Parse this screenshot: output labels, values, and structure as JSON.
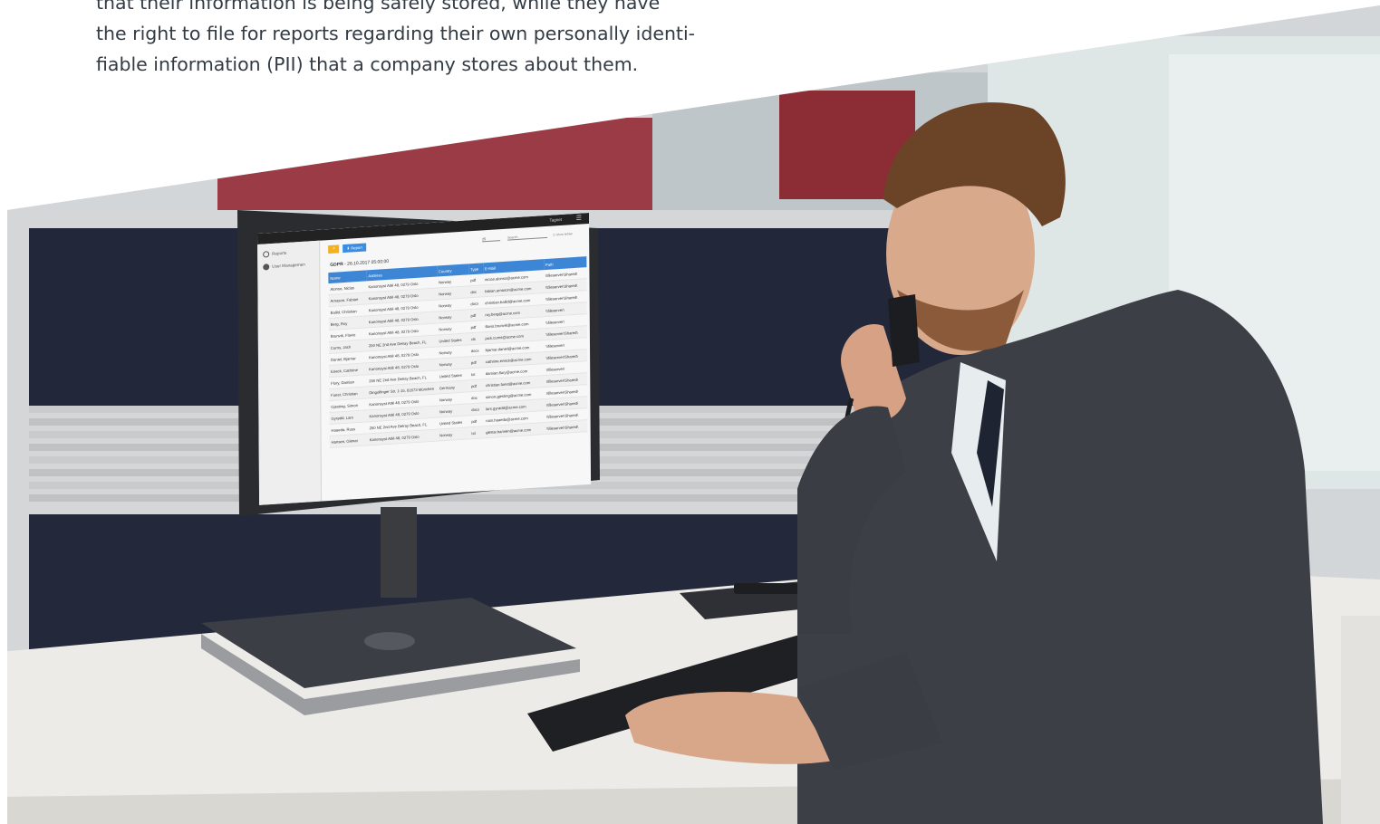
{
  "intro": {
    "lines": [
      "that their information is being safely stored, while they have",
      "the right to file for reports regarding their own personally identi-",
      "fiable information (PII) that a company stores about them."
    ]
  },
  "screen": {
    "brand": "Tagnet",
    "sidebar": [
      {
        "label": "Reports",
        "icon": "clock-icon"
      },
      {
        "label": "User Managemen",
        "icon": "user-icon"
      }
    ],
    "toolbar": {
      "yellow_label": "+",
      "blue_label": "⬇ Report",
      "select_value": "25",
      "search_placeholder": "Search",
      "checkbox_label": "☐ Show hidden"
    },
    "report_title_bold": "GDPR",
    "report_title_rest": " - 26.10.2017 05:00:00",
    "table": {
      "headers": [
        "Name",
        "Address",
        "Country",
        "Type",
        "E-Mail",
        "Path"
      ],
      "rows": [
        [
          "Alonso, Niclas",
          "Kanonsyst Atlé 48, 0279 Oslo",
          "Norway",
          "pdf",
          "nicias.alonso@acme.com",
          "\\\\fileserver\\Shared\\"
        ],
        [
          "Arnason, Fabian",
          "Kanonsyst Atlé 48, 0279 Oslo",
          "Norway",
          "doc",
          "fabian.arnason@acme.com",
          "\\\\fileserver\\Shared\\"
        ],
        [
          "Balild, Christian",
          "Kanonsyst Atlé 48, 0279 Oslo",
          "Norway",
          "docx",
          "christian.balild@acme.com",
          "\\\\fileserver\\Shared\\"
        ],
        [
          "Berg, Roy",
          "Kanonsyst Atlé 48, 0279 Oslo",
          "Norway",
          "pdf",
          "roy.berg@acme.com",
          "\\\\fileserver\\"
        ],
        [
          "Brunvik, Flavio",
          "Kanonsyst Atlé 48, 0279 Oslo",
          "Norway",
          "pdf",
          "flavio.brunvik@acme.com",
          "\\\\fileserver\\"
        ],
        [
          "Curns, Jack",
          "250 NE 2nd Ave Delray Beach, FL",
          "United States",
          "xls",
          "jack.curns@acme.com",
          "\\\\fileserver\\Shared\\"
        ],
        [
          "Daniel, Bjarnar",
          "Kanonsyst Atlé 48, 0279 Oslo",
          "Norway",
          "docx",
          "bjarnar.daniel@acme.com",
          "\\\\fileserver\\"
        ],
        [
          "Eneck, Cathrine",
          "Kanonsyst Atlé 48, 0279 Oslo",
          "Norway",
          "pdf",
          "cathrine.eneck@acme.com",
          "\\\\fileserver\\Shared\\"
        ],
        [
          "Flury, Damian",
          "250 NE 2nd Ave Delray Beach, FL",
          "United States",
          "txt",
          "damian.flury@acme.com",
          "\\\\fileserver\\"
        ],
        [
          "Fuest, Christian",
          "Dingolfinger Str. 1-15, 81673 München",
          "Germany",
          "pdf",
          "christian.fuest@acme.com",
          "\\\\fileserver\\Shared\\"
        ],
        [
          "Gjesting, Simon",
          "Kanonsyst Atlé 48, 0279 Oslo",
          "Norway",
          "doc",
          "simon.gjesting@acme.com",
          "\\\\fileserver\\Shared\\"
        ],
        [
          "Gyrødd, Lars",
          "Kanonsyst Atlé 48, 0279 Oslo",
          "Norway",
          "docx",
          "lars.gyrødd@acme.com",
          "\\\\fileserver\\Shared\\"
        ],
        [
          "Haaeda, Russ",
          "250 NE 2nd Ave Delray Beach, FL",
          "United States",
          "pdf",
          "russ.haaeda@acme.com",
          "\\\\fileserver\\Shared\\"
        ],
        [
          "Hansen, Glenar",
          "Kanonsyst Atlé 48, 0279 Oslo",
          "Norway",
          "txt",
          "glenar.hansen@acme.com",
          "\\\\fileserver\\Shared\\"
        ]
      ]
    }
  },
  "colors": {
    "text_dark": "#333b44",
    "table_header": "#3d86d6",
    "button_yellow": "#f3b21c",
    "button_blue": "#3a8de0"
  }
}
